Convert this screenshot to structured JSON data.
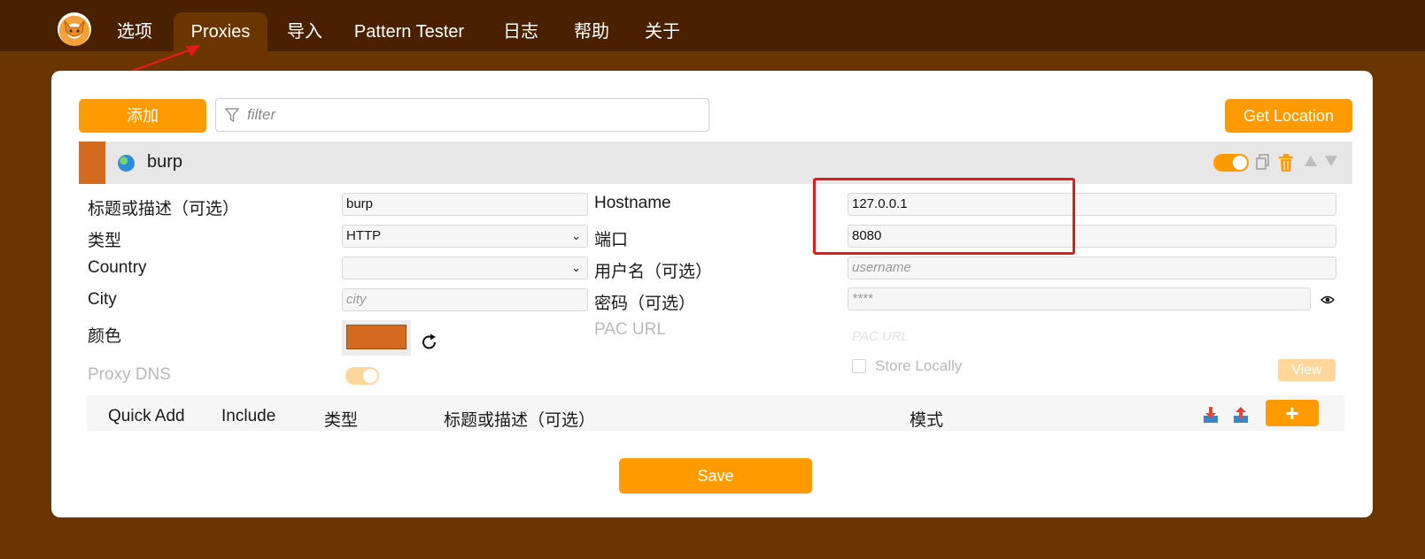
{
  "nav": {
    "tabs": [
      {
        "label": "选项"
      },
      {
        "label": "Proxies"
      },
      {
        "label": "导入"
      },
      {
        "label": "Pattern Tester"
      },
      {
        "label": "日志"
      },
      {
        "label": "帮助"
      },
      {
        "label": "关于"
      }
    ],
    "active_tab": "Proxies"
  },
  "toolbar": {
    "add_label": "添加",
    "filter_placeholder": "filter",
    "get_location_label": "Get Location"
  },
  "proxy": {
    "title": "burp",
    "color": "#d56a21",
    "enabled": true,
    "left": {
      "title_label": "标题或描述（可选）",
      "title_value": "burp",
      "type_label": "类型",
      "type_value": "HTTP",
      "country_label": "Country",
      "country_value": "",
      "city_label": "City",
      "city_placeholder": "city",
      "color_label": "颜色",
      "proxy_dns_label": "Proxy DNS"
    },
    "right": {
      "hostname_label": "Hostname",
      "hostname_value": "127.0.0.1",
      "port_label": "端口",
      "port_value": "8080",
      "username_label": "用户名（可选）",
      "username_placeholder": "username",
      "password_label": "密码（可选）",
      "password_placeholder": "****",
      "pac_url_label": "PAC URL",
      "pac_url_placeholder": "PAC URL",
      "store_locally_label": "Store Locally",
      "view_label": "View"
    }
  },
  "patterns": {
    "columns": [
      "Quick Add",
      "Include",
      "类型",
      "标题或描述（可选）",
      "模式"
    ]
  },
  "save_label": "Save",
  "colors": {
    "background": "#6b3500",
    "topbar": "#4a2100",
    "accent": "#ff9b00",
    "highlight_box": "#e21b1b"
  }
}
